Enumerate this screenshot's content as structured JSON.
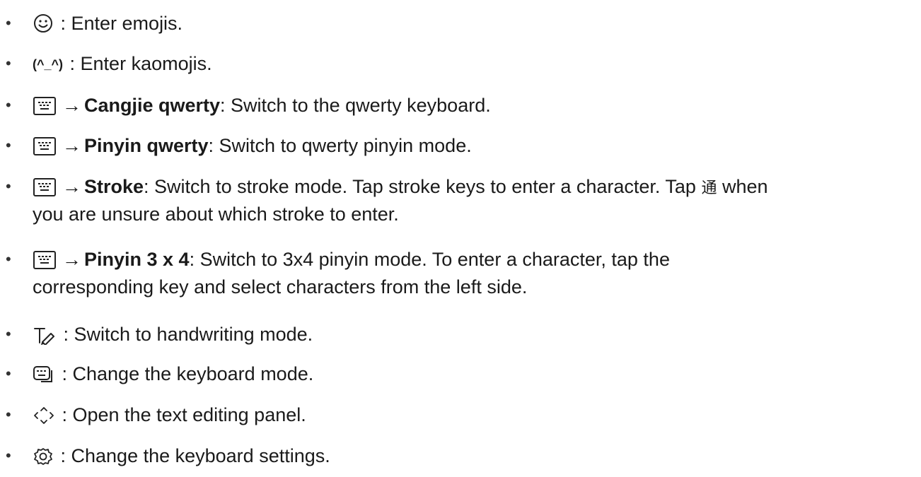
{
  "items": [
    {
      "icon": "emoji-icon",
      "text": " : Enter emojis."
    },
    {
      "icon_text": "(^_^)",
      "text": " : Enter kaomojis."
    },
    {
      "icon": "keyboard-icon",
      "arrow": "→",
      "bold": "Cangjie qwerty",
      "text": ": Switch to the qwerty keyboard."
    },
    {
      "icon": "keyboard-icon",
      "arrow": "→",
      "bold": "Pinyin qwerty",
      "text": ": Switch to qwerty pinyin mode."
    },
    {
      "icon": "keyboard-icon",
      "arrow": "→",
      "bold": "Stroke",
      "text": ": Switch to stroke mode. Tap stroke keys to enter a character. Tap ",
      "glyph": "通",
      "text_after": " when",
      "continuation": "you are unsure about which stroke to enter."
    },
    {
      "icon": "keyboard-icon",
      "arrow": "→",
      "bold": "Pinyin 3 x 4",
      "text": ": Switch to 3x4 pinyin mode. To enter a character, tap the",
      "continuation": "corresponding key and select characters from the left side."
    },
    {
      "icon": "handwriting-icon",
      "text": " : Switch to handwriting mode."
    },
    {
      "icon": "keyboard-mode-icon",
      "text": " : Change the keyboard mode."
    },
    {
      "icon": "text-editing-icon",
      "text": " : Open the text editing panel."
    },
    {
      "icon": "settings-gear-icon",
      "text": " : Change the keyboard settings."
    }
  ],
  "bullet_char": "•"
}
